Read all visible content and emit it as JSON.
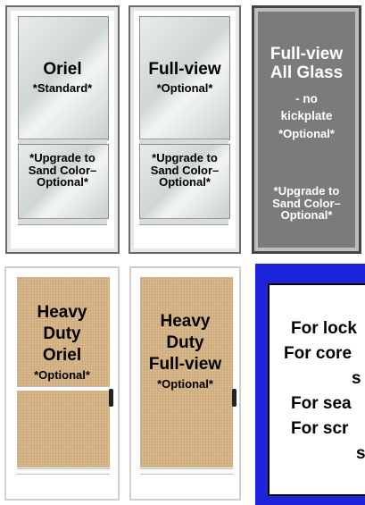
{
  "doors": [
    {
      "name": "Oriel",
      "note": "*Standard*",
      "upgrade": "*Upgrade to Sand Color– Optional*"
    },
    {
      "name": "Full-view",
      "note": "*Optional*",
      "upgrade": "*Upgrade to Sand Color– Optional*"
    },
    {
      "name_line1": "Full-view",
      "name_line2": "All Glass",
      "name_line3": "-  no",
      "name_line4": "kickplate",
      "note": "*Optional*",
      "upgrade": "*Upgrade to Sand Color– Optional*"
    },
    {
      "name_line1": "Heavy",
      "name_line2": "Duty",
      "name_line3": "Oriel",
      "note": "*Optional*"
    },
    {
      "name_line1": "Heavy",
      "name_line2": "Duty",
      "name_line3": "Full-view",
      "note": "*Optional*"
    }
  ],
  "info_box": {
    "lines": [
      "For lock",
      "For core",
      "s",
      "For sea",
      "For scr",
      "s"
    ]
  },
  "colors": {
    "info_border": "#1d24d9",
    "sand": "#d7b88d",
    "gray_door": "#7b7b7b"
  }
}
